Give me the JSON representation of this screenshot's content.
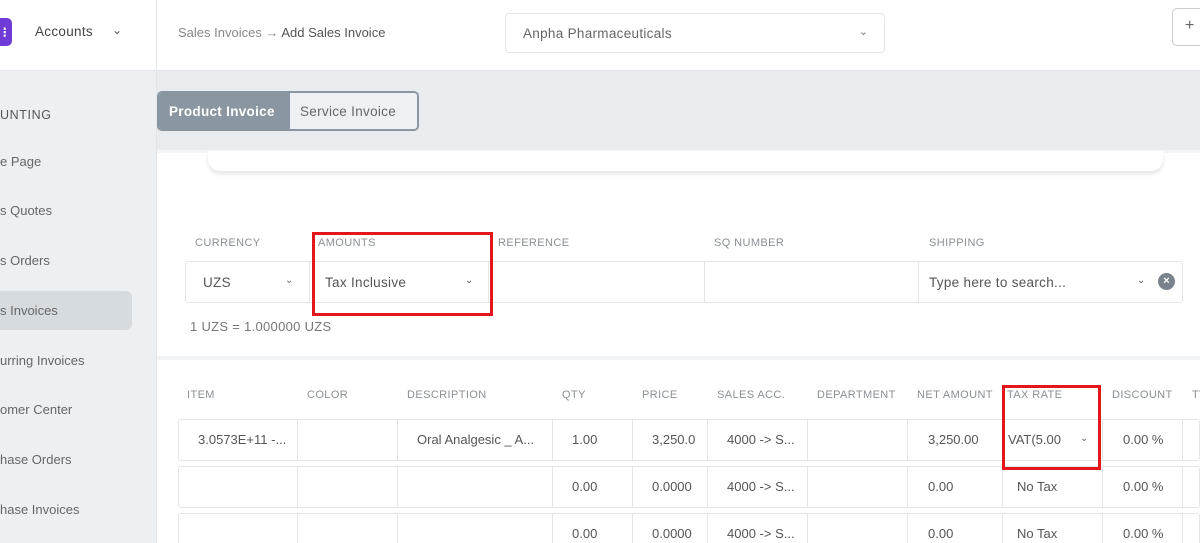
{
  "sidebar": {
    "title": "Accounts",
    "section": "UNTING",
    "items": [
      {
        "label": "e Page"
      },
      {
        "label": "s Quotes"
      },
      {
        "label": "s Orders"
      },
      {
        "label": "s Invoices"
      },
      {
        "label": "urring Invoices"
      },
      {
        "label": "omer Center"
      },
      {
        "label": "hase Orders"
      },
      {
        "label": "hase Invoices"
      }
    ]
  },
  "header": {
    "breadcrumb_parent": "Sales Invoices",
    "breadcrumb_sep": "→",
    "breadcrumb_current": "Add Sales Invoice",
    "company": "Anpha Pharmaceuticals",
    "plus": "+"
  },
  "tabs": {
    "product": "Product Invoice",
    "service": "Service Invoice"
  },
  "form": {
    "currency_label": "CURRENCY",
    "amounts_label": "AMOUNTS",
    "reference_label": "REFERENCE",
    "sq_label": "SQ NUMBER",
    "shipping_label": "SHIPPING",
    "currency_value": "UZS",
    "amounts_value": "Tax Inclusive",
    "reference_value": "",
    "sq_value": "",
    "shipping_placeholder": "Type here to search...",
    "exchange_rate": "1 UZS = 1.000000 UZS"
  },
  "table": {
    "headers": {
      "item": "ITEM",
      "color": "COLOR",
      "description": "DESCRIPTION",
      "qty": "QTY",
      "price": "PRICE",
      "sales_acc": "SALES ACC.",
      "department": "DEPARTMENT",
      "net_amount": "NET AMOUNT",
      "tax_rate": "TAX RATE",
      "discount": "DISCOUNT",
      "tv": "TV"
    },
    "rows": [
      {
        "item": "3.0573E+11 -...",
        "color": "",
        "description": "Oral Analgesic _ A...",
        "qty": "1.00",
        "price": "3,250.0",
        "sales_acc": "4000 -> S...",
        "department": "",
        "net_amount": "3,250.00",
        "tax_rate": "VAT(5.00",
        "discount": "0.00 %"
      },
      {
        "item": "",
        "color": "",
        "description": "",
        "qty": "0.00",
        "price": "0.0000",
        "sales_acc": "4000 -> S...",
        "department": "",
        "net_amount": "0.00",
        "tax_rate": "No Tax",
        "discount": "0.00 %"
      },
      {
        "item": "",
        "color": "",
        "description": "",
        "qty": "0.00",
        "price": "0.0000",
        "sales_acc": "4000 -> S...",
        "department": "",
        "net_amount": "0.00",
        "tax_rate": "No Tax",
        "discount": "0.00 %"
      }
    ]
  },
  "colors": {
    "highlight": "#e2161b",
    "logo": "#6f3bd6",
    "toggle_active": "#8a96a2"
  }
}
